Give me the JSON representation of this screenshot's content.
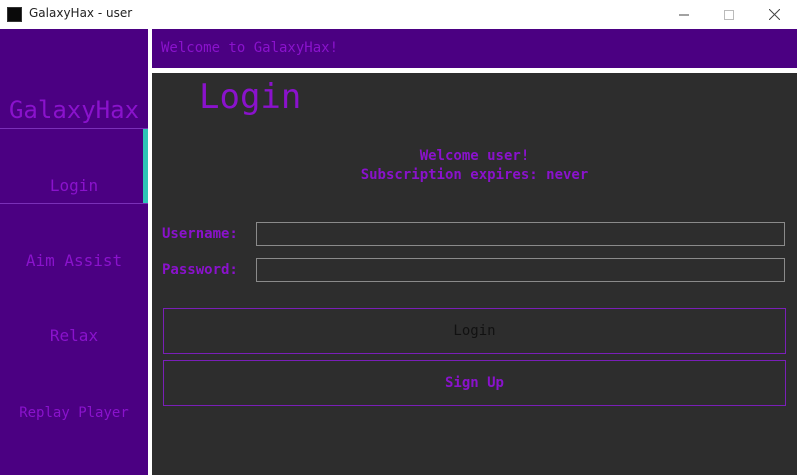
{
  "window": {
    "title": "GalaxyHax - user",
    "icon": "app-icon",
    "controls": [
      "minimize-icon",
      "maximize-icon",
      "close-icon"
    ]
  },
  "sidebar": {
    "brand": "GalaxyHax",
    "items": [
      {
        "label": "Login",
        "active": true
      },
      {
        "label": "Aim Assist",
        "active": false
      },
      {
        "label": "Relax",
        "active": false
      },
      {
        "label": "Replay Player",
        "active": false
      }
    ]
  },
  "header": {
    "text": "Welcome to GalaxyHax!"
  },
  "main": {
    "title": "Login",
    "welcome_line1": "Welcome user!",
    "welcome_line2": "Subscription expires: never",
    "username_label": "Username:",
    "username_value": "",
    "password_label": "Password:",
    "password_value": "",
    "login_button": "Login",
    "signup_button": "Sign Up"
  },
  "colors": {
    "sidebar_bg": "#4b0082",
    "accent_text": "#8a12cc",
    "content_bg": "#2d2d2d",
    "active_indicator": "#2ec4b6"
  }
}
